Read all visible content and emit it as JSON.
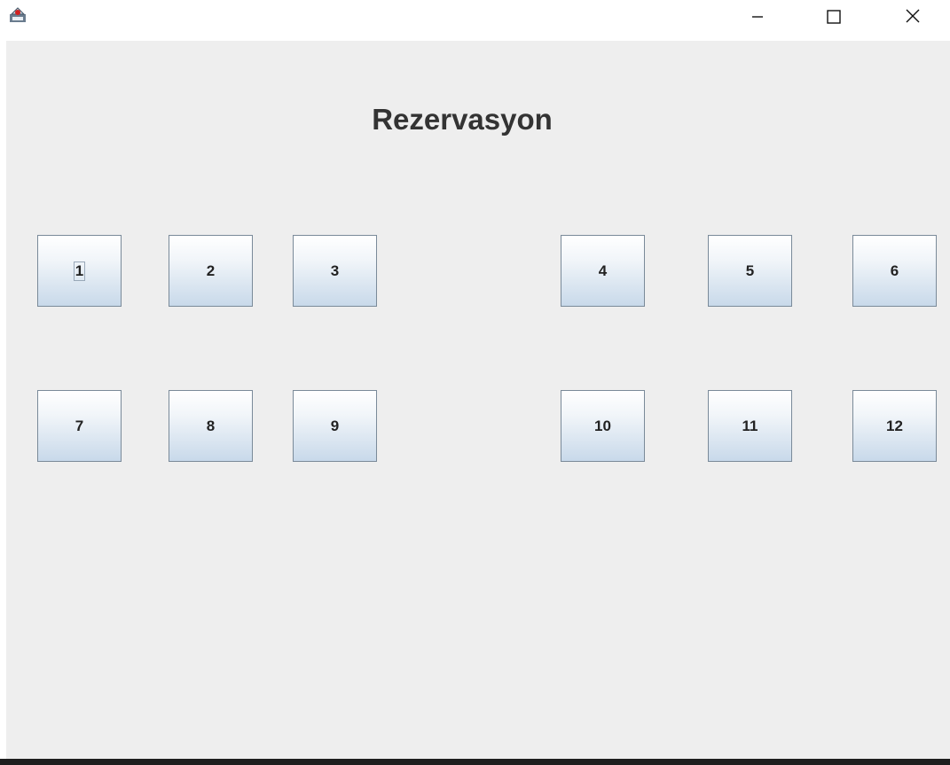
{
  "window": {
    "controls": {
      "minimize_icon": "minimize-icon",
      "maximize_icon": "maximize-icon",
      "close_icon": "close-icon"
    },
    "app_icon": "java-app-icon"
  },
  "main": {
    "title": "Rezervasyon",
    "seats": [
      {
        "label": "1",
        "focused": true
      },
      {
        "label": "2"
      },
      {
        "label": "3"
      },
      {
        "label": "4"
      },
      {
        "label": "5"
      },
      {
        "label": "6"
      },
      {
        "label": "7"
      },
      {
        "label": "8"
      },
      {
        "label": "9"
      },
      {
        "label": "10"
      },
      {
        "label": "11"
      },
      {
        "label": "12"
      }
    ]
  },
  "colors": {
    "background": "#eeeeee",
    "title_text": "#333333",
    "button_border": "#7a8a99",
    "button_gradient_bottom": "#c8d9ea"
  }
}
